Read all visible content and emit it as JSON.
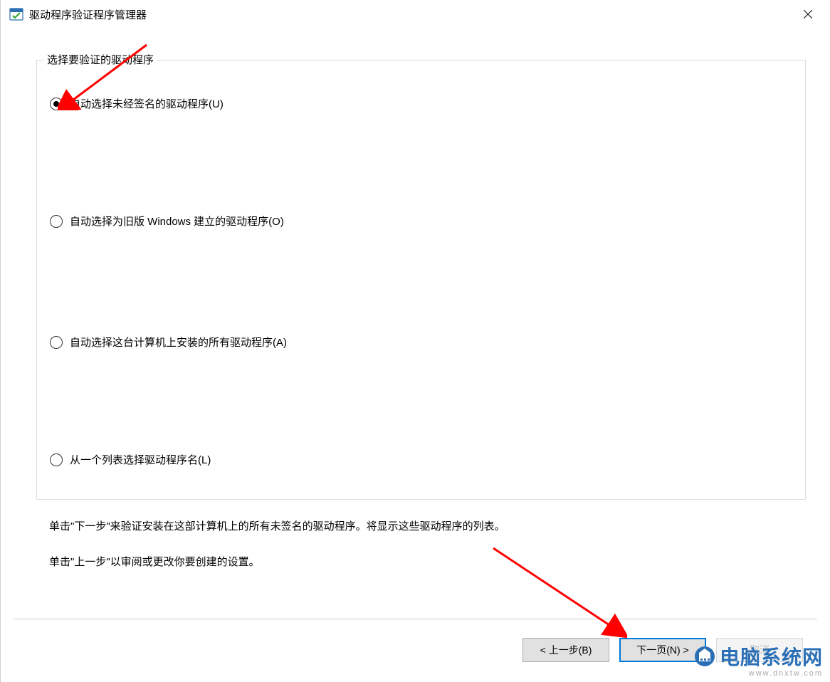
{
  "window": {
    "title": "驱动程序验证程序管理器"
  },
  "group": {
    "legend": "选择要验证的驱动程序",
    "options": [
      {
        "label": "自动选择未经签名的驱动程序(U)",
        "checked": true
      },
      {
        "label": "自动选择为旧版 Windows 建立的驱动程序(O)",
        "checked": false
      },
      {
        "label": "自动选择这台计算机上安装的所有驱动程序(A)",
        "checked": false
      },
      {
        "label": "从一个列表选择驱动程序名(L)",
        "checked": false
      }
    ]
  },
  "help": {
    "line1": "单击\"下一步\"来验证安装在这部计算机上的所有未签名的驱动程序。将显示这些驱动程序的列表。",
    "line2": "单击\"上一步\"以审阅或更改你要创建的设置。"
  },
  "buttons": {
    "back": "< 上一步(B)",
    "next": "下一页(N) >",
    "cancel": "取消"
  },
  "watermark": {
    "main": "电脑系统网",
    "sub": "www.dnxtw.com"
  }
}
